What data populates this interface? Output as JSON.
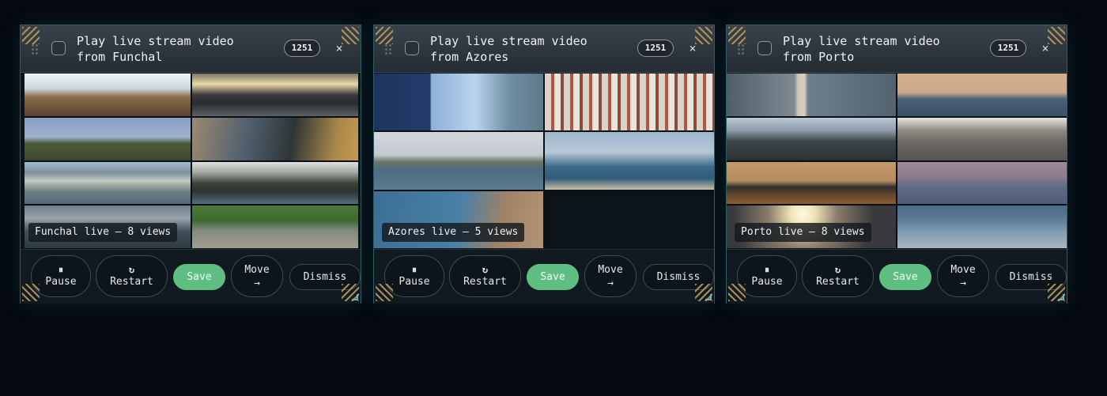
{
  "cards": [
    {
      "title": "Play live stream video from Funchal",
      "count": "1251",
      "close": "×",
      "caption": "Funchal live — 8 views",
      "actions": {
        "pause_icon": "⏸",
        "pause": "Pause",
        "restart_icon": "↻",
        "restart": "Restart",
        "save": "Save",
        "move": "Move",
        "move_icon": "→",
        "dismiss": "Dismiss"
      }
    },
    {
      "title": "Play live stream video from Azores",
      "count": "1251",
      "close": "×",
      "caption": "Azores live — 5 views",
      "actions": {
        "pause_icon": "⏸",
        "pause": "Pause",
        "restart_icon": "↻",
        "restart": "Restart",
        "save": "Save",
        "move": "Move",
        "move_icon": "→",
        "dismiss": "Dismiss"
      }
    },
    {
      "title": "Play live stream video from Porto",
      "count": "1251",
      "close": "×",
      "caption": "Porto live — 8 views",
      "actions": {
        "pause_icon": "⏸",
        "pause": "Pause",
        "restart_icon": "↻",
        "restart": "Restart",
        "save": "Save",
        "move": "Move",
        "move_icon": "→",
        "dismiss": "Dismiss"
      }
    }
  ],
  "colors": {
    "background": "#050a12",
    "card_border": "#2f5f66",
    "save_green": "#5fbf82",
    "corner_gold": "#b99a5a"
  },
  "icons": [
    "drag-handle-icon",
    "checkbox-icon",
    "close-icon",
    "pause-icon",
    "restart-icon",
    "arrow-right-icon"
  ]
}
